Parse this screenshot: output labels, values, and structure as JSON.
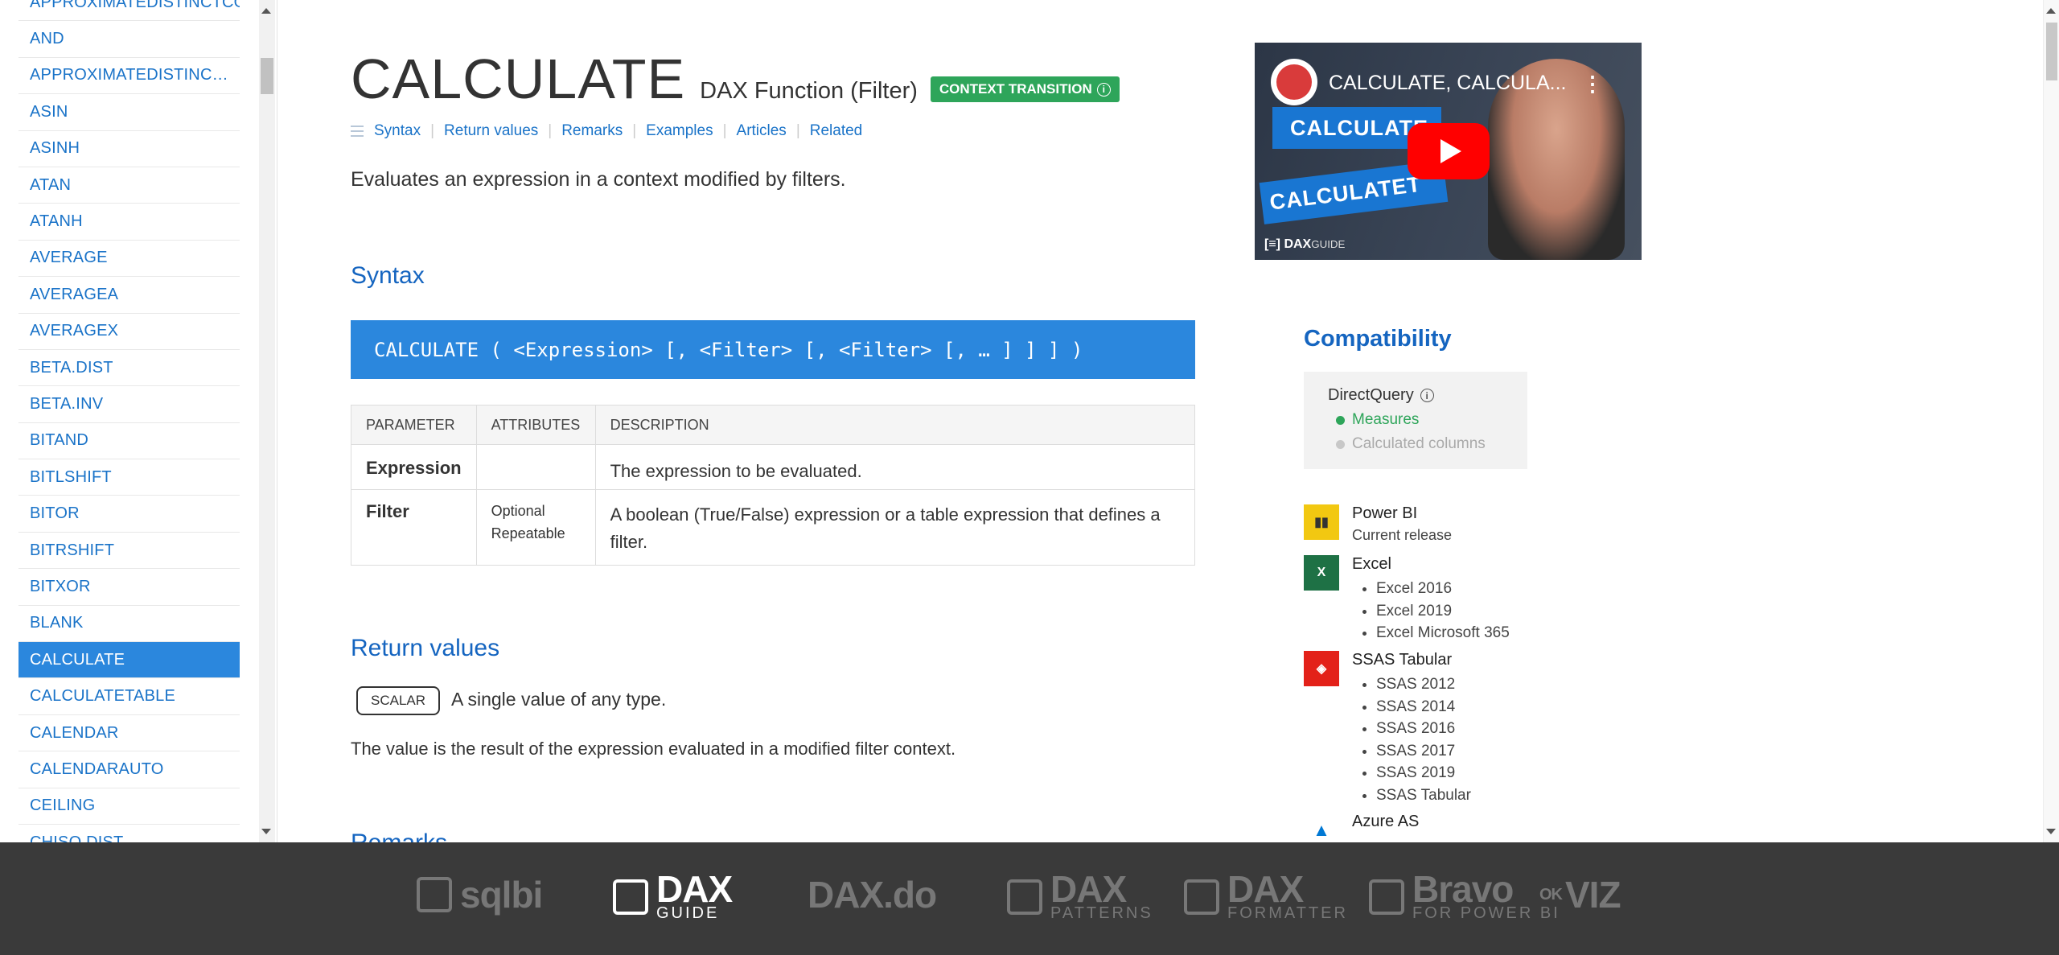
{
  "sidebar": {
    "items": [
      {
        "label": "APPROXIMATEDISTINCTCOUNT",
        "active": false
      },
      {
        "label": "AND",
        "active": false
      },
      {
        "label": "APPROXIMATEDISTINC…",
        "active": false
      },
      {
        "label": "ASIN",
        "active": false
      },
      {
        "label": "ASINH",
        "active": false
      },
      {
        "label": "ATAN",
        "active": false
      },
      {
        "label": "ATANH",
        "active": false
      },
      {
        "label": "AVERAGE",
        "active": false
      },
      {
        "label": "AVERAGEA",
        "active": false
      },
      {
        "label": "AVERAGEX",
        "active": false
      },
      {
        "label": "BETA.DIST",
        "active": false
      },
      {
        "label": "BETA.INV",
        "active": false
      },
      {
        "label": "BITAND",
        "active": false
      },
      {
        "label": "BITLSHIFT",
        "active": false
      },
      {
        "label": "BITOR",
        "active": false
      },
      {
        "label": "BITRSHIFT",
        "active": false
      },
      {
        "label": "BITXOR",
        "active": false
      },
      {
        "label": "BLANK",
        "active": false
      },
      {
        "label": "CALCULATE",
        "active": true
      },
      {
        "label": "CALCULATETABLE",
        "active": false
      },
      {
        "label": "CALENDAR",
        "active": false
      },
      {
        "label": "CALENDARAUTO",
        "active": false
      },
      {
        "label": "CEILING",
        "active": false
      },
      {
        "label": "CHISQ.DIST",
        "active": false
      }
    ]
  },
  "page": {
    "title": "CALCULATE",
    "subtitle": "DAX Function (Filter)",
    "badge": "CONTEXT TRANSITION",
    "badge_color": "#2ea55a",
    "toc": [
      "Syntax",
      "Return values",
      "Remarks",
      "Examples",
      "Articles",
      "Related"
    ],
    "description": "Evaluates an expression in a context modified by filters."
  },
  "syntax": {
    "heading": "Syntax",
    "code": "CALCULATE ( <Expression> [, <Filter> [, <Filter> [, … ] ] ] )",
    "columns": [
      "PARAMETER",
      "ATTRIBUTES",
      "DESCRIPTION"
    ],
    "rows": [
      {
        "parameter": "Expression",
        "attr1": "",
        "attr2": "",
        "description": "The expression to be evaluated."
      },
      {
        "parameter": "Filter",
        "attr1": "Optional",
        "attr2": "Repeatable",
        "description": "A boolean (True/False) expression or a table expression that defines a filter."
      }
    ]
  },
  "return_values": {
    "heading": "Return values",
    "type": "SCALAR",
    "type_text": "A single value of any type.",
    "note": "The value is the result of the expression evaluated in a modified filter context."
  },
  "remarks": {
    "heading": "Remarks"
  },
  "video": {
    "title": "CALCULATE, CALCULA...",
    "band1": "CALCULATE",
    "band2": "CALCULATET",
    "brand": "DAX",
    "brand_sub": "GUIDE"
  },
  "compat": {
    "heading": "Compatibility",
    "directquery_title": "DirectQuery",
    "directquery_items": [
      {
        "label": "Measures",
        "supported": true
      },
      {
        "label": "Calculated columns",
        "supported": false
      }
    ],
    "products": [
      {
        "name": "Power BI",
        "sub": "Current release",
        "versions": [],
        "icon_color": "#f2c811"
      },
      {
        "name": "Excel",
        "sub": "",
        "versions": [
          "Excel 2016",
          "Excel 2019",
          "Excel Microsoft 365"
        ],
        "icon_color": "#1e7145"
      },
      {
        "name": "SSAS Tabular",
        "sub": "",
        "versions": [
          "SSAS 2012",
          "SSAS 2014",
          "SSAS 2016",
          "SSAS 2017",
          "SSAS 2019",
          "SSAS Tabular"
        ],
        "icon_color": "#e32119"
      },
      {
        "name": "Azure AS",
        "sub": "",
        "versions": [],
        "icon_color": "#0078d4"
      }
    ]
  },
  "footer": {
    "logos": [
      {
        "name": "sqlbi",
        "active": false
      },
      {
        "name": "DAX",
        "sub": "GUIDE",
        "active": true
      },
      {
        "name": "DAX.do",
        "active": false
      },
      {
        "name": "DAX",
        "sub": "PATTERNS",
        "active": false
      },
      {
        "name": "DAX",
        "sub": "FORMATTER",
        "active": false
      },
      {
        "name": "Bravo",
        "sub": "FOR POWER BI",
        "active": false
      },
      {
        "name": "VIZ",
        "sub": "OK",
        "active": false
      }
    ]
  }
}
